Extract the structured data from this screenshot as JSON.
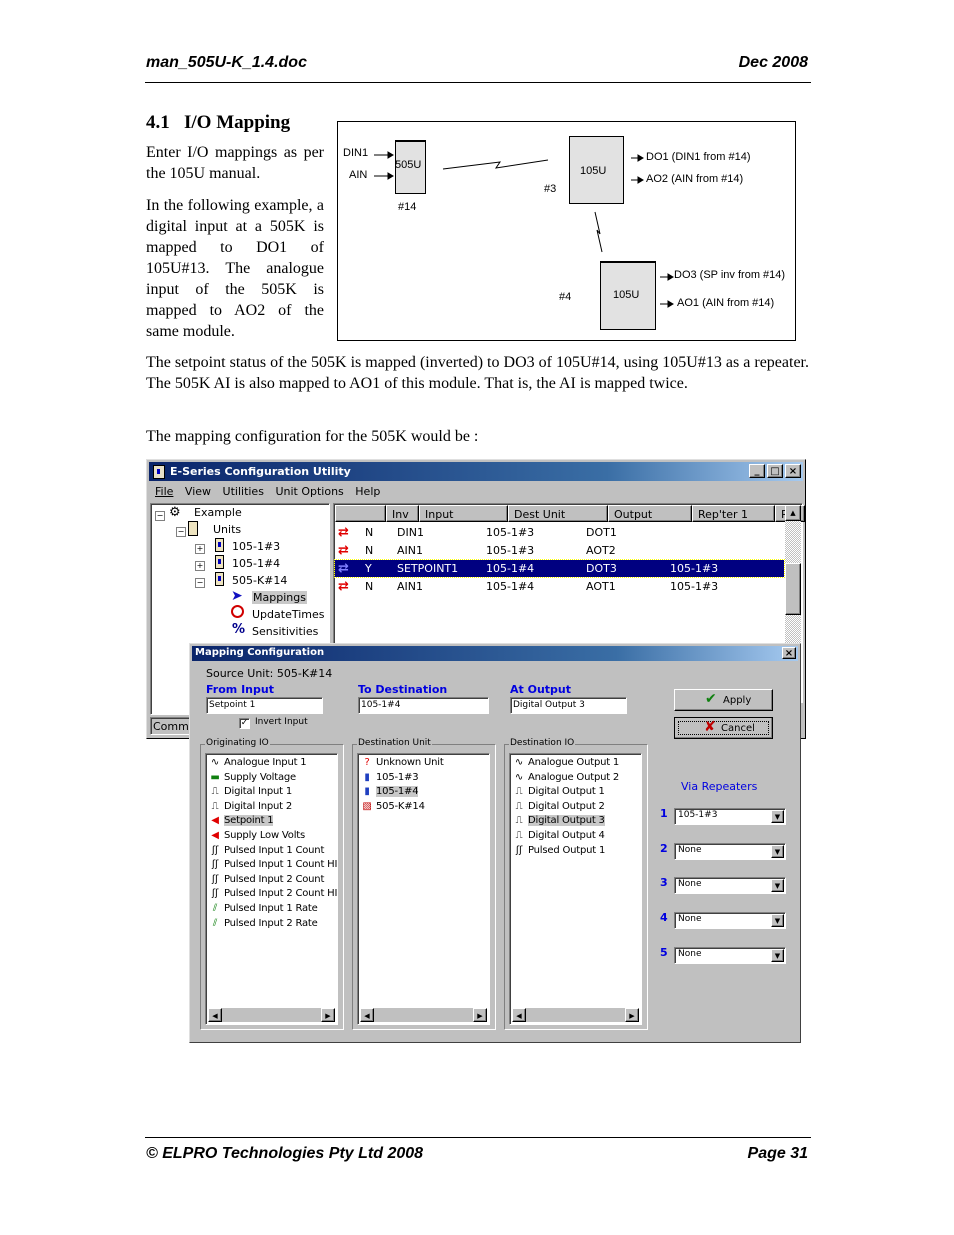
{
  "header": {
    "left": "man_505U-K_1.4.doc",
    "right": "Dec 2008"
  },
  "section": {
    "number": "4.1",
    "title": "I/O Mapping"
  },
  "side_paragraphs": [
    "Enter I/O mappings as per the 105U manual.",
    "In the following example, a digital input at a 505K is mapped to DO1 of 105U#13. The analogue input of the 505K is mapped to AO2 of the same module."
  ],
  "diagram": {
    "unit_505": {
      "label": "505U",
      "id": "#14",
      "inputs": [
        "DIN1",
        "AIN"
      ]
    },
    "unit_105_a": {
      "label": "105U",
      "id": "#3",
      "outputs": [
        "DO1 (DIN1 from #14)",
        "AO2 (AIN from #14)"
      ]
    },
    "unit_105_b": {
      "label": "105U",
      "id": "#4",
      "outputs": [
        "DO3 (SP inv from #14)",
        "AO1 (AIN from #14)"
      ]
    }
  },
  "body_paragraphs": [
    "The setpoint status of the 505K is mapped (inverted) to DO3 of 105U#14, using 105U#13 as a repeater. The 505K AI is also mapped to AO1 of this module. That is, the AI is mapped twice.",
    "The mapping configuration for the 505K would be :"
  ],
  "app": {
    "title": "E-Series Configuration Utility",
    "menu": [
      "File",
      "View",
      "Utilities",
      "Unit Options",
      "Help"
    ],
    "tree": {
      "root": "Example",
      "units": "Units",
      "items": [
        "105-1#3",
        "105-1#4",
        "505-K#14"
      ],
      "children": [
        "Mappings",
        "UpdateTimes",
        "Sensitivities"
      ]
    },
    "status_fragment": "Comm F",
    "table": {
      "columns": [
        "",
        "Inv",
        "Input",
        "Dest Unit",
        "Output",
        "Rep'ter 1",
        "R...",
        "F"
      ],
      "rows": [
        {
          "inv": "N",
          "input": "DIN1",
          "dest": "105-1#3",
          "output": "DOT1",
          "rep1": "",
          "selected": false
        },
        {
          "inv": "N",
          "input": "AIN1",
          "dest": "105-1#3",
          "output": "AOT2",
          "rep1": "",
          "selected": false
        },
        {
          "inv": "Y",
          "input": "SETPOINT1",
          "dest": "105-1#4",
          "output": "DOT3",
          "rep1": "105-1#3",
          "selected": true
        },
        {
          "inv": "N",
          "input": "AIN1",
          "dest": "105-1#4",
          "output": "AOT1",
          "rep1": "105-1#3",
          "selected": false
        }
      ]
    }
  },
  "dialog": {
    "title": "Mapping Configuration",
    "source_unit": "Source Unit:  505-K#14",
    "from_label": "From   Input",
    "from_value": "Setpoint 1",
    "to_label": "To Destination",
    "to_value": "105-1#4",
    "at_label": "At  Output",
    "at_value": "Digital Output 3",
    "invert_label": "Invert Input",
    "invert_checked": true,
    "apply_label": "Apply",
    "cancel_label": "Cancel",
    "originating_label": "Originating IO",
    "originating_items": [
      {
        "icon": "analog-wave",
        "label": "Analogue Input 1"
      },
      {
        "icon": "battery",
        "label": "Supply Voltage"
      },
      {
        "icon": "digital-pulse",
        "label": "Digital Input 1"
      },
      {
        "icon": "digital-pulse",
        "label": "Digital Input 2"
      },
      {
        "icon": "setpoint",
        "label": "Setpoint 1",
        "selected": true
      },
      {
        "icon": "setpoint",
        "label": "Supply Low Volts"
      },
      {
        "icon": "pulse-train",
        "label": "Pulsed Input 1 Count"
      },
      {
        "icon": "pulse-train",
        "label": "Pulsed Input 1 Count HI"
      },
      {
        "icon": "pulse-train",
        "label": "Pulsed Input 2 Count"
      },
      {
        "icon": "pulse-train",
        "label": "Pulsed Input 2 Count HI"
      },
      {
        "icon": "pulse-rate",
        "label": "Pulsed Input 1 Rate"
      },
      {
        "icon": "pulse-rate",
        "label": "Pulsed Input 2 Rate"
      }
    ],
    "dest_unit_label": "Destination Unit",
    "dest_unit_items": [
      {
        "icon": "unknown",
        "label": "Unknown Unit"
      },
      {
        "icon": "unit",
        "label": "105-1#3"
      },
      {
        "icon": "unit",
        "label": "105-1#4",
        "selected": true
      },
      {
        "icon": "unit-disabled",
        "label": "505-K#14"
      }
    ],
    "dest_io_label": "Destination IO",
    "dest_io_items": [
      {
        "icon": "analog-wave",
        "label": "Analogue Output 1"
      },
      {
        "icon": "analog-wave",
        "label": "Analogue Output 2"
      },
      {
        "icon": "digital-pulse",
        "label": "Digital Output 1"
      },
      {
        "icon": "digital-pulse",
        "label": "Digital Output 2"
      },
      {
        "icon": "digital-pulse",
        "label": "Digital Output 3",
        "selected": true
      },
      {
        "icon": "digital-pulse",
        "label": "Digital Output 4"
      },
      {
        "icon": "pulse-train",
        "label": "Pulsed Output 1"
      }
    ],
    "repeaters_label": "Via Repeaters",
    "repeaters": [
      {
        "num": "1",
        "value": "105-1#3"
      },
      {
        "num": "2",
        "value": "None"
      },
      {
        "num": "3",
        "value": "None"
      },
      {
        "num": "4",
        "value": "None"
      },
      {
        "num": "5",
        "value": "None"
      }
    ]
  },
  "footer": {
    "left": "© ELPRO Technologies Pty Ltd 2008",
    "right": "Page 31"
  }
}
